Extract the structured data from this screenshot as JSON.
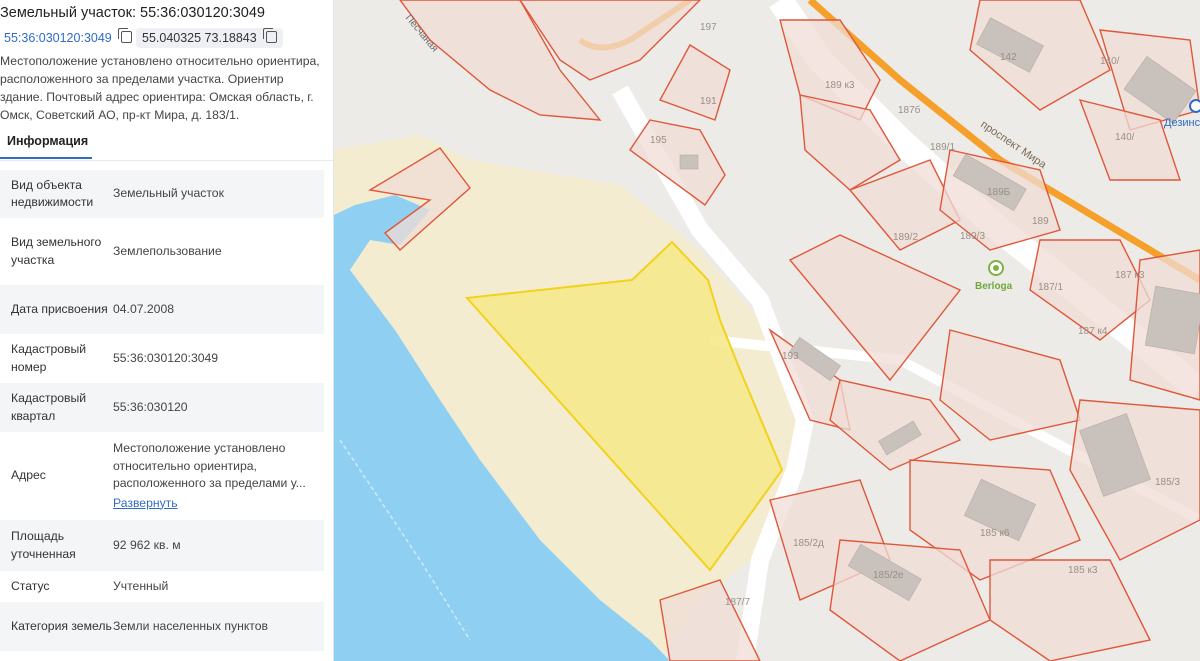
{
  "panel": {
    "title": "Земельный участок: 55:36:030120:3049",
    "cadastral_chip": "55:36:030120:3049",
    "coords_chip": "55.040325 73.18843",
    "location_description": "Местоположение установлено относительно ориентира, расположенного за пределами участка. Ориентир здание. Почтовый адрес ориентира: Омская область, г. Омск, Советский АО, пр-кт Мира, д. 183/1.",
    "tab_info": "Информация",
    "rows": [
      {
        "label": "Вид объекта недвижимости",
        "value": "Земельный участок"
      },
      {
        "label": "Вид земельного участка",
        "value": "Землепользование"
      },
      {
        "label": "Дата присвоения",
        "value": "04.07.2008"
      },
      {
        "label": "Кадастровый номер",
        "value": "55:36:030120:3049"
      },
      {
        "label": "Кадастровый квартал",
        "value": "55:36:030120"
      },
      {
        "label": "Адрес",
        "value": "Местоположение установлено относительно ориентира, расположенного за пределами у...",
        "link": "Развернуть"
      },
      {
        "label": "Площадь уточненная",
        "value": "92 962 кв. м"
      },
      {
        "label": "Статус",
        "value": "Учтенный"
      },
      {
        "label": "Категория земель",
        "value": "Земли населенных пунктов"
      }
    ]
  },
  "map": {
    "street_label": "проспект Мира",
    "street_label_2": "Песчаная",
    "poi_label": "Berloga",
    "edge_label": "Дезинс",
    "house_numbers": [
      "191",
      "195",
      "197",
      "142",
      "140/",
      "140/",
      "189 к3",
      "187б",
      "189/1",
      "189Б",
      "189",
      "189/3",
      "189/2",
      "187/1",
      "187 к3",
      "187 к4",
      "193",
      "185/3",
      "185 к6",
      "185/2д",
      "185/2е",
      "185 к3",
      "187/7"
    ],
    "colors": {
      "water": "#8fd0f2",
      "sand": "#f3ecd0",
      "parcel_fill": "#f0dcd5",
      "parcel_stroke": "#e0573a",
      "selected_fill": "#f5ea8c",
      "selected_stroke": "#f2d21c",
      "road": "#f5a02a",
      "link": "#2f6bc8"
    }
  }
}
